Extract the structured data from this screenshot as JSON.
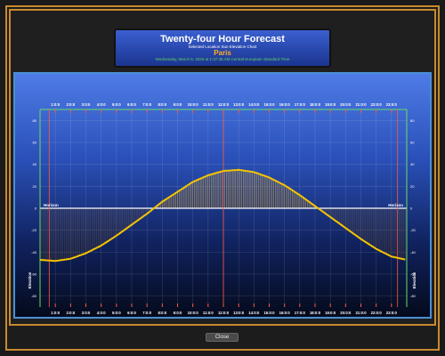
{
  "header": {
    "title": "Twenty-four Hour Forecast",
    "subtitle": "Selected Location Sun Elevation Chart",
    "location": "Paris",
    "datetime": "Wednesday, March 5, 2025 at 1:37:38 AM Central European Standard Time"
  },
  "close_label": "Close",
  "colors": {
    "sun": "#f5c400",
    "horizon": "#ffffff",
    "sunrise": "#ff5a3c",
    "edge": "#66dd66"
  },
  "chart_data": {
    "type": "area",
    "x_ticks": [
      "1:0:0",
      "2:0:0",
      "3:0:0",
      "4:0:0",
      "5:0:0",
      "6:0:0",
      "7:0:0",
      "8:0:0",
      "9:0:0",
      "10:0:0",
      "11:0:0",
      "12:0:0",
      "13:0:0",
      "14:0:0",
      "15:0:0",
      "16:0:0",
      "17:0:0",
      "18:0:0",
      "19:0:0",
      "20:0:0",
      "21:0:0",
      "22:0:0",
      "23:0:0"
    ],
    "y_ticks": [
      "80",
      "60",
      "40",
      "20",
      "0",
      "-20",
      "-40",
      "-60",
      "-80"
    ],
    "ylim": [
      -90,
      90
    ],
    "xlim": [
      0,
      24
    ],
    "horizon_label": "Horizon",
    "ylabel": "Elevation",
    "series": [
      {
        "x": [
          0,
          1,
          2,
          3,
          4,
          5,
          6,
          7,
          8,
          9,
          10,
          11,
          12,
          13,
          14,
          15,
          16,
          17,
          18,
          19,
          20,
          21,
          22,
          23,
          24
        ],
        "values": [
          -47,
          -48,
          -46,
          -41,
          -34,
          -25,
          -15,
          -5,
          6,
          15,
          24,
          30,
          34,
          35,
          33,
          28,
          21,
          12,
          2,
          -8,
          -18,
          -28,
          -37,
          -44,
          -47
        ]
      }
    ],
    "sunrise_hour": 7.4,
    "sunset_hour": 18.3
  }
}
